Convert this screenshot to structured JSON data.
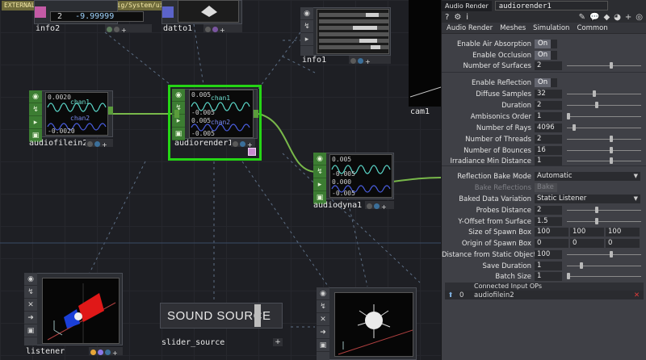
{
  "external_bar": "EXTERNAL TOX:... 5.31760/Config/System/ui.tox",
  "nodes": {
    "info2": {
      "name": "info2",
      "field_a": "2",
      "field_b": "-9.99999"
    },
    "datto1": {
      "name": "datto1"
    },
    "info1": {
      "name": "info1"
    },
    "cam1": {
      "name": "cam1"
    },
    "audiofilein2": {
      "name": "audiofilein2",
      "labels": [
        "0.0020",
        "chan1",
        "chan2",
        "-0.0020"
      ]
    },
    "audiorender1": {
      "name": "audiorender1",
      "labels": [
        "0.005",
        "chan1",
        "-0.005",
        "0.005",
        "chan2",
        "-0.005"
      ]
    },
    "audiodyna1": {
      "name": "audiodyna1",
      "labels": [
        "0.005",
        "-0.005",
        "0.000",
        "-0.005"
      ]
    },
    "listener": {
      "name": "listener"
    },
    "slider_source": {
      "name": "slider_source",
      "text": "SOUND SOURCE"
    },
    "source_node": {
      "name": ""
    }
  },
  "panel": {
    "op_type": "Audio Render",
    "op_name": "audiorender1",
    "tabs": [
      "Audio Render",
      "Meshes",
      "Simulation",
      "Common"
    ],
    "params": [
      {
        "label": "Enable Air Absorption",
        "kind": "toggle",
        "value": "On"
      },
      {
        "label": "Enable Occlusion",
        "kind": "toggle",
        "value": "On"
      },
      {
        "label": "Number of Surfaces",
        "kind": "slider",
        "value": "2",
        "pos": 0.6
      },
      {
        "label": "Enable Reflection",
        "kind": "toggle",
        "value": "On"
      },
      {
        "label": "Diffuse Samples",
        "kind": "slider",
        "value": "32",
        "pos": 0.37
      },
      {
        "label": "Duration",
        "kind": "slider",
        "value": "2",
        "pos": 0.4
      },
      {
        "label": "Ambisonics Order",
        "kind": "slider",
        "value": "1",
        "pos": 0.02
      },
      {
        "label": "Number of Rays",
        "kind": "slider",
        "value": "4096",
        "pos": 0.1
      },
      {
        "label": "Number of Threads",
        "kind": "slider",
        "value": "2",
        "pos": 0.6
      },
      {
        "label": "Number of Bounces",
        "kind": "slider",
        "value": "16",
        "pos": 0.6
      },
      {
        "label": "Irradiance Min Distance",
        "kind": "slider",
        "value": "1",
        "pos": 0.6
      },
      {
        "label": "Reflection Bake Mode",
        "kind": "menu",
        "value": "Automatic"
      },
      {
        "label": "Bake Reflections",
        "kind": "button",
        "value": "Bake",
        "disabled": true
      },
      {
        "label": "Baked Data Variation",
        "kind": "menu",
        "value": "Static Listener"
      },
      {
        "label": "Probes Distance",
        "kind": "slider",
        "value": "2",
        "pos": 0.4
      },
      {
        "label": "Y-Offset from Surface",
        "kind": "slider",
        "value": "1.5",
        "pos": 0.4
      },
      {
        "label": "Size of Spawn Box",
        "kind": "triple",
        "values": [
          "100",
          "100",
          "100"
        ]
      },
      {
        "label": "Origin of Spawn Box",
        "kind": "triple",
        "values": [
          "0",
          "0",
          "0"
        ]
      },
      {
        "label": "Distance from Static Object",
        "kind": "slider",
        "value": "100",
        "pos": 0.6
      },
      {
        "label": "Save Duration",
        "kind": "slider",
        "value": "1",
        "pos": 0.2
      },
      {
        "label": "Batch Size",
        "kind": "slider",
        "value": "1",
        "pos": 0.02
      }
    ],
    "inputs_header": "Connected Input OPs",
    "inputs": [
      {
        "index": "0",
        "name": "audiofilein2"
      }
    ]
  }
}
